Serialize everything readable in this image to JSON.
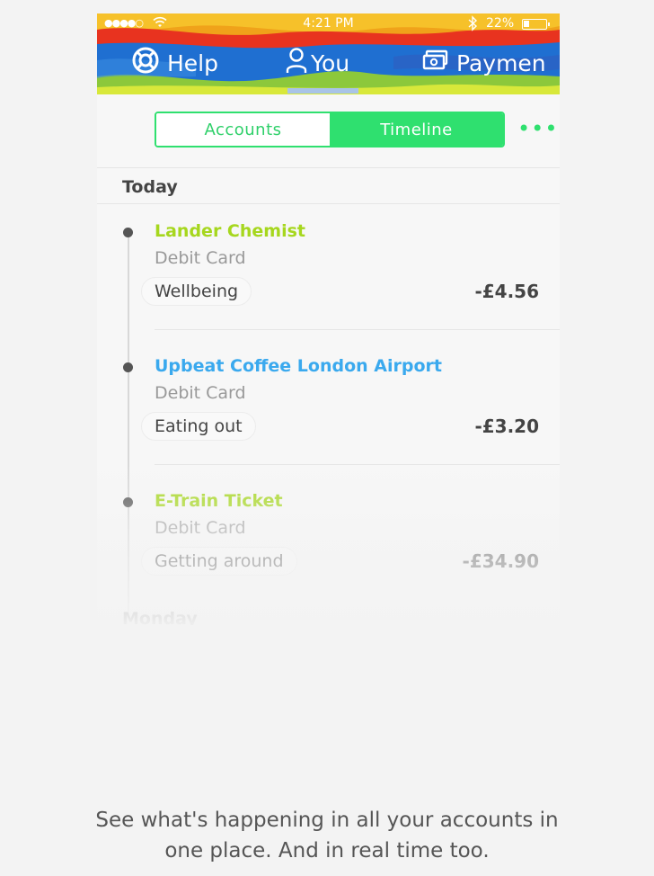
{
  "status_bar": {
    "signal": "●●●●○",
    "time": "4:21 PM",
    "battery_text": "22%"
  },
  "nav": {
    "tabs": [
      {
        "label": "Help",
        "icon": "lifebuoy-icon"
      },
      {
        "label": "You",
        "icon": "person-icon"
      },
      {
        "label": "Paymen",
        "icon": "cash-icon"
      }
    ],
    "active_tab": "You"
  },
  "segmented": {
    "accounts_label": "Accounts",
    "timeline_label": "Timeline",
    "active": "Timeline",
    "more_label": "•••"
  },
  "sections": [
    {
      "heading": "Today",
      "transactions": [
        {
          "merchant": "Lander Chemist",
          "card": "Debit Card",
          "category": "Wellbeing",
          "amount": "-£4.56",
          "color": "#a6d71e"
        },
        {
          "merchant": "Upbeat Coffee London Airport",
          "card": "Debit Card",
          "category": "Eating out",
          "amount": "-£3.20",
          "color": "#3aa9ee"
        },
        {
          "merchant": "E-Train Ticket",
          "card": "Debit Card",
          "category": "Getting around",
          "amount": "-£34.90",
          "color": "#a6d71e"
        }
      ]
    },
    {
      "heading": "Monday"
    }
  ],
  "caption": {
    "line1": "See what's happening in all your accounts in",
    "line2": "one place. And in real time too."
  },
  "colors": {
    "accent_green": "#2fe06f",
    "lime": "#a6d71e",
    "blue": "#3aa9ee"
  }
}
